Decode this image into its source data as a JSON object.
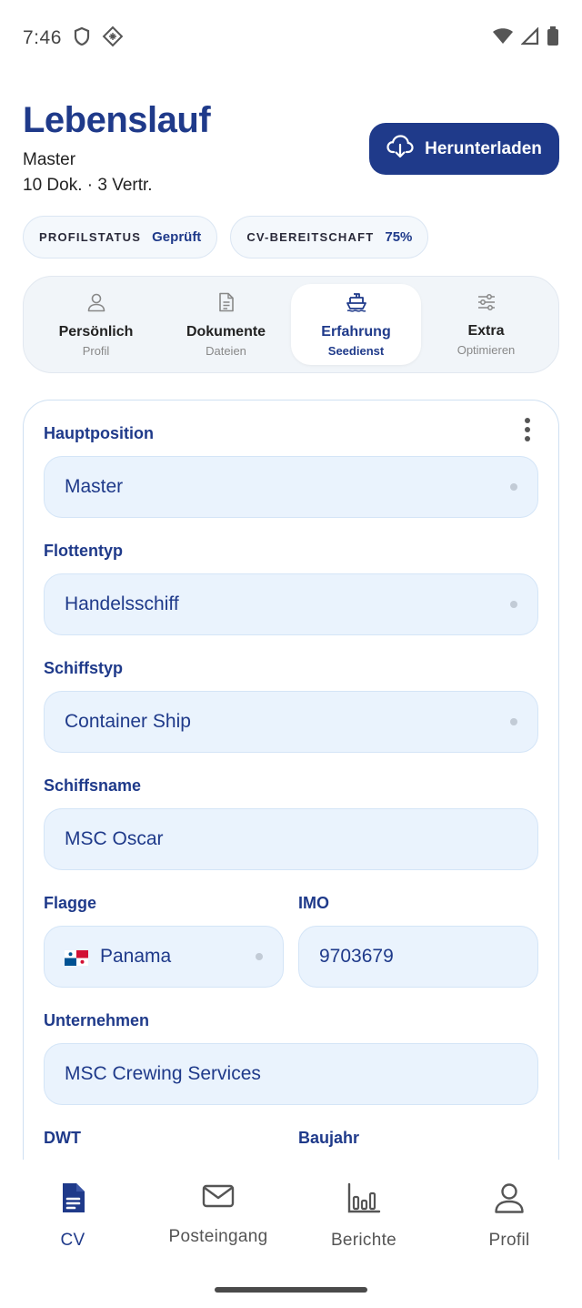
{
  "status_bar": {
    "time": "7:46"
  },
  "header": {
    "title": "Lebenslauf",
    "subtitle": "Master",
    "counts": "10 Dok. · 3 Vertr.",
    "download_label": "Herunterladen"
  },
  "chips": [
    {
      "label": "PROFILSTATUS",
      "value": "Geprüft"
    },
    {
      "label": "CV-BEREITSCHAFT",
      "value": "75%"
    }
  ],
  "tabs": [
    {
      "label": "Persönlich",
      "sub": "Profil",
      "icon": "person-icon"
    },
    {
      "label": "Dokumente",
      "sub": "Dateien",
      "icon": "document-icon"
    },
    {
      "label": "Erfahrung",
      "sub": "Seedienst",
      "icon": "ship-icon",
      "active": true
    },
    {
      "label": "Extra",
      "sub": "Optimieren",
      "icon": "sliders-icon"
    }
  ],
  "form": {
    "main_position": {
      "label": "Hauptposition",
      "value": "Master"
    },
    "fleet_type": {
      "label": "Flottentyp",
      "value": "Handelsschiff"
    },
    "ship_type": {
      "label": "Schiffstyp",
      "value": "Container Ship"
    },
    "ship_name": {
      "label": "Schiffsname",
      "value": "MSC Oscar"
    },
    "flag": {
      "label": "Flagge",
      "value": "Panama"
    },
    "imo": {
      "label": "IMO",
      "value": "9703679"
    },
    "company": {
      "label": "Unternehmen",
      "value": "MSC Crewing Services"
    },
    "dwt": {
      "label": "DWT"
    },
    "year_built": {
      "label": "Baujahr"
    }
  },
  "bottom_nav": [
    {
      "label": "CV",
      "icon": "cv-document-icon",
      "active": true
    },
    {
      "label": "Posteingang",
      "icon": "mail-icon"
    },
    {
      "label": "Berichte",
      "icon": "bar-chart-icon"
    },
    {
      "label": "Profil",
      "icon": "user-icon"
    }
  ],
  "colors": {
    "primary": "#1f3a8a",
    "field_bg": "#eaf3fd",
    "border": "#cfe0f2"
  }
}
